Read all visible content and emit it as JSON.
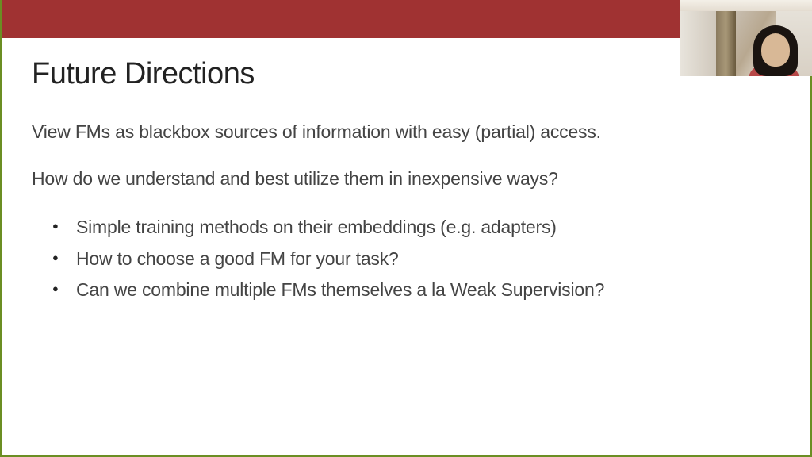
{
  "slide": {
    "title": "Future Directions",
    "paragraphs": [
      "View FMs as blackbox sources of information with easy (partial) access.",
      "How do we understand and best utilize them in inexpensive ways?"
    ],
    "bullets": [
      "Simple training methods on their embeddings (e.g. adapters)",
      "How to choose a good FM for your task?",
      "Can we combine multiple FMs themselves a la Weak Supervision?"
    ]
  },
  "colors": {
    "header": "#a03232",
    "border": "#6b8e23"
  }
}
